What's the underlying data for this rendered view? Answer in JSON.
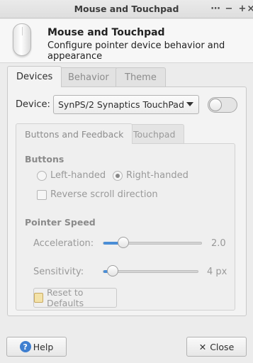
{
  "window": {
    "title": "Mouse and Touchpad"
  },
  "header": {
    "title": "Mouse and Touchpad",
    "subtitle": "Configure pointer device behavior and appearance"
  },
  "tabs": [
    {
      "label": "Devices"
    },
    {
      "label": "Behavior"
    },
    {
      "label": "Theme"
    }
  ],
  "device": {
    "label": "Device:",
    "selected": "SynPS/2 Synaptics TouchPad",
    "enabled_level": 0
  },
  "subtabs": [
    {
      "label": "Buttons and Feedback"
    },
    {
      "label": "Touchpad"
    }
  ],
  "buttons_section": {
    "title": "Buttons",
    "left_handed": "Left-handed",
    "right_handed": "Right-handed",
    "reverse_scroll": "Reverse scroll direction"
  },
  "pointer_speed": {
    "title": "Pointer Speed",
    "acceleration_label": "Acceleration:",
    "acceleration_value": "2.0",
    "acceleration_level": 0.2,
    "sensitivity_label": "Sensitivity:",
    "sensitivity_value": "4 px",
    "sensitivity_level": 0.1,
    "reset_label": "Reset to Defaults"
  },
  "footer": {
    "help_label": "Help",
    "close_label": "Close"
  }
}
